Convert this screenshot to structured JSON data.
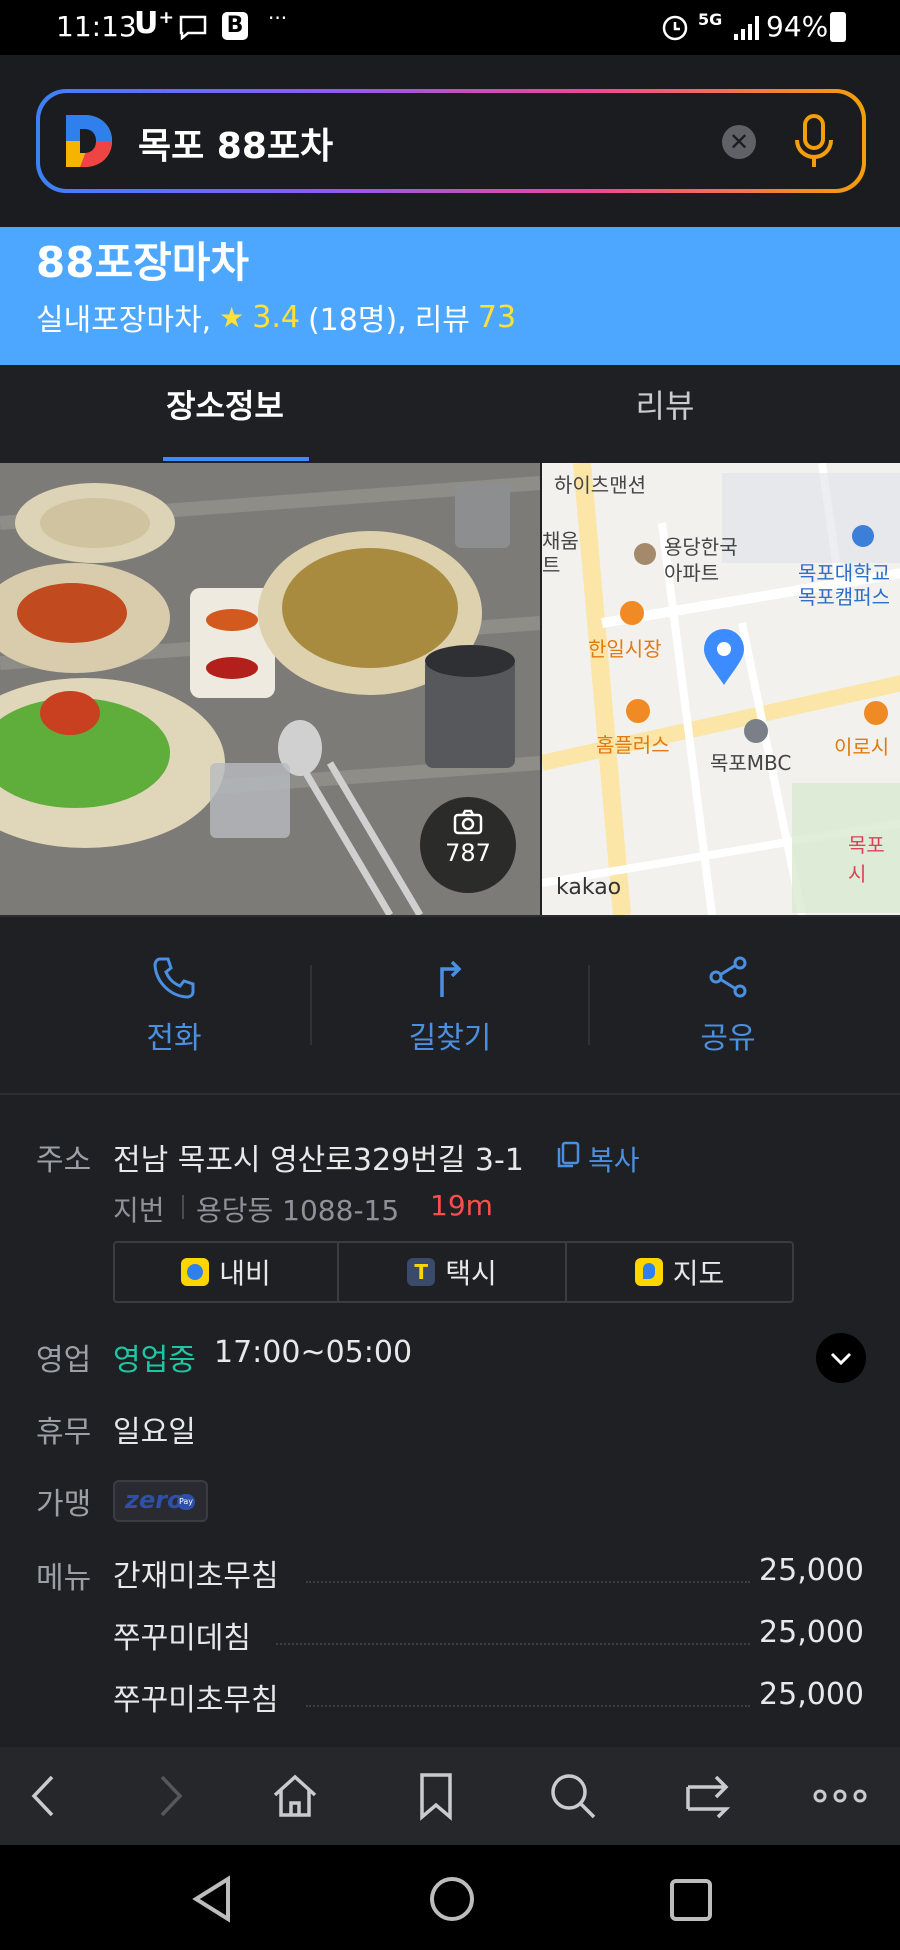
{
  "status_bar": {
    "time": "11:13",
    "carrier": "U⁺",
    "battery": "94%",
    "network": "5G"
  },
  "search": {
    "query": "목포 88포차"
  },
  "place": {
    "name": "88포장마차",
    "category": "실내포장마차,",
    "rating": "3.4",
    "rating_count": "(18명),",
    "review_label": "리뷰",
    "review_count": "73"
  },
  "tabs": [
    {
      "label": "장소정보"
    },
    {
      "label": "리뷰"
    }
  ],
  "photo": {
    "count": "787"
  },
  "map": {
    "brand": "kakao",
    "labels": [
      "하이츠맨션",
      "채움",
      "트",
      "용당한국",
      "아파트",
      "한일시장",
      "목포대학교",
      "목포캠퍼스",
      "홈플러스",
      "목포MBC",
      "이로시",
      "목포시"
    ]
  },
  "actions": [
    {
      "label": "전화"
    },
    {
      "label": "길찾기"
    },
    {
      "label": "공유"
    }
  ],
  "info": {
    "address_label": "주소",
    "address": "전남 목포시 영산로329번길 3-1",
    "copy_label": "복사",
    "jibun_label": "지번",
    "jibun": "용당동 1088-15",
    "distance": "19m",
    "nav_buttons": [
      {
        "label": "내비"
      },
      {
        "label": "택시"
      },
      {
        "label": "지도"
      }
    ],
    "hours_label": "영업",
    "hours_status": "영업중",
    "hours": "17:00~05:00",
    "closed_label": "휴무",
    "closed": "일요일",
    "partner_label": "가맹",
    "partner_badge": "zero",
    "partner_badge_sub": "Pay",
    "menu_label": "메뉴",
    "menu": [
      {
        "name": "간재미초무침",
        "price": "25,000"
      },
      {
        "name": "쭈꾸미데침",
        "price": "25,000"
      },
      {
        "name": "쭈꾸미초무침",
        "price": "25,000"
      }
    ]
  },
  "colors": {
    "accent_blue": "#4da7ff",
    "star_yellow": "#ffe135",
    "open_green": "#1fc6a6",
    "distance_red": "#ff4d4d",
    "link_blue": "#4a90e2"
  }
}
